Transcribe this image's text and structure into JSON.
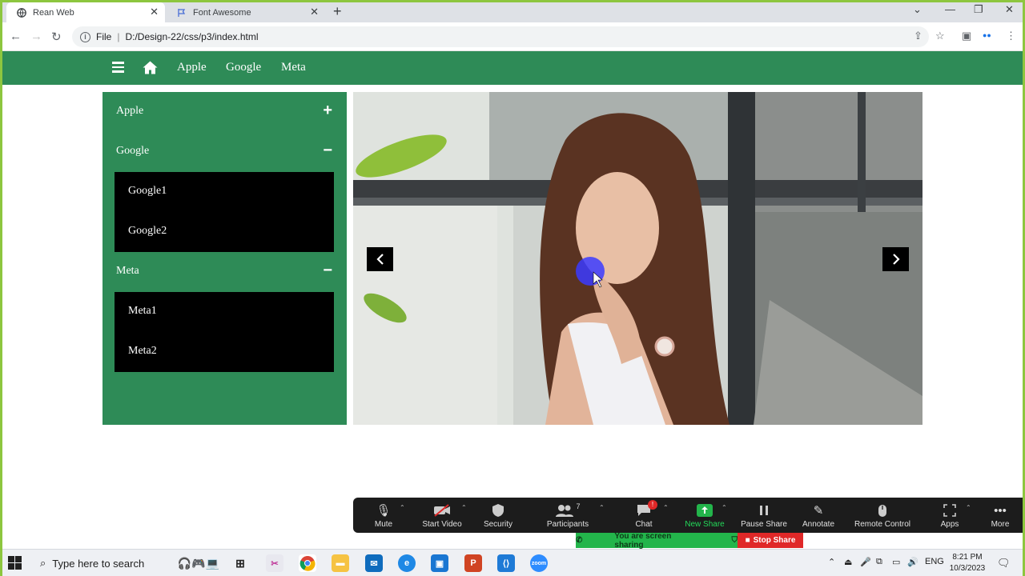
{
  "browser": {
    "tabs": [
      {
        "title": "Rean Web",
        "icon": "globe-icon",
        "active": true
      },
      {
        "title": "Font Awesome",
        "icon": "flag-icon",
        "active": false
      }
    ],
    "address": {
      "scheme_label": "File",
      "url": "D:/Design-22/css/p3/index.html"
    }
  },
  "site": {
    "brand_color": "#2e8b57",
    "nav_links": [
      "Apple",
      "Google",
      "Meta"
    ],
    "sidebar": [
      {
        "label": "Apple",
        "state": "+",
        "items": []
      },
      {
        "label": "Google",
        "state": "−",
        "items": [
          "Google1",
          "Google2"
        ]
      },
      {
        "label": "Meta",
        "state": "−",
        "items": [
          "Meta1",
          "Meta2"
        ]
      }
    ],
    "slider": {
      "prev_icon": "chevron-left-icon",
      "next_icon": "chevron-right-icon"
    }
  },
  "zoom": {
    "items": [
      {
        "label": "Mute",
        "icon": "microphone-icon"
      },
      {
        "label": "Start Video",
        "icon": "video-off-icon"
      },
      {
        "label": "Security",
        "icon": "shield-icon"
      },
      {
        "label": "Participants",
        "icon": "participants-icon",
        "count": "7"
      },
      {
        "label": "Chat",
        "icon": "chat-icon",
        "badge": "!"
      },
      {
        "label": "New Share",
        "icon": "share-icon"
      },
      {
        "label": "Pause Share",
        "icon": "pause-icon"
      },
      {
        "label": "Annotate",
        "icon": "pencil-icon"
      },
      {
        "label": "Remote Control",
        "icon": "mouse-icon"
      },
      {
        "label": "Apps",
        "icon": "apps-icon"
      },
      {
        "label": "More",
        "icon": "more-icon"
      }
    ],
    "sharing_text": "You are screen sharing",
    "stop_share": "Stop Share"
  },
  "taskbar": {
    "search_placeholder": "Type here to search",
    "lang": "ENG",
    "time": "8:21 PM",
    "date": "10/3/2023"
  }
}
